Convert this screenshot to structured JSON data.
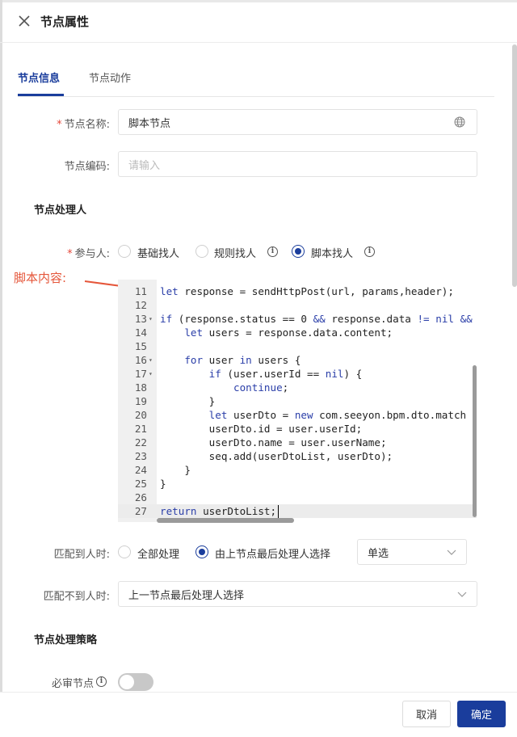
{
  "header": {
    "title": "节点属性"
  },
  "tabs": [
    {
      "label": "节点信息"
    },
    {
      "label": "节点动作"
    }
  ],
  "form": {
    "node_name": {
      "label": "节点名称:",
      "value": "脚本节点"
    },
    "node_code": {
      "label": "节点编码:",
      "placeholder": "请输入"
    },
    "handler_section": "节点处理人",
    "participant": {
      "label": "参与人:",
      "options": [
        "基础找人",
        "规则找人",
        "脚本找人"
      ],
      "selected": "脚本找人"
    },
    "script_annotation": "脚本内容:",
    "match_found": {
      "label": "匹配到人时:",
      "options": [
        "全部处理",
        "由上节点最后处理人选择"
      ],
      "selected": "由上节点最后处理人选择",
      "select_value": "单选"
    },
    "match_not_found": {
      "label": "匹配不到人时:",
      "value": "上一节点最后处理人选择"
    },
    "strategy_section": "节点处理策略",
    "must_review": {
      "label": "必审节点",
      "enabled": false
    }
  },
  "code": {
    "lines": [
      {
        "n": "11",
        "text": "let response = sendHttpPost(url, params,header);"
      },
      {
        "n": "12",
        "text": ""
      },
      {
        "n": "13",
        "text": "if (response.status == 0 && response.data != nil &&",
        "fold": true
      },
      {
        "n": "14",
        "text": "    let users = response.data.content;"
      },
      {
        "n": "15",
        "text": ""
      },
      {
        "n": "16",
        "text": "    for user in users {",
        "fold": true
      },
      {
        "n": "17",
        "text": "        if (user.userId == nil) {",
        "fold": true
      },
      {
        "n": "18",
        "text": "            continue;"
      },
      {
        "n": "19",
        "text": "        }"
      },
      {
        "n": "20",
        "text": "        let userDto = new com.seeyon.bpm.dto.match"
      },
      {
        "n": "21",
        "text": "        userDto.id = user.userId;"
      },
      {
        "n": "22",
        "text": "        userDto.name = user.userName;"
      },
      {
        "n": "23",
        "text": "        seq.add(userDtoList, userDto);"
      },
      {
        "n": "24",
        "text": "    }"
      },
      {
        "n": "25",
        "text": "}"
      },
      {
        "n": "26",
        "text": ""
      },
      {
        "n": "27",
        "text": "return userDtoList;",
        "current": true
      }
    ]
  },
  "footer": {
    "cancel_label": "取消",
    "ok_label": "确定"
  },
  "colors": {
    "accent": "#1a3d9c",
    "required": "#e5483a",
    "annotation": "#e5563a"
  }
}
